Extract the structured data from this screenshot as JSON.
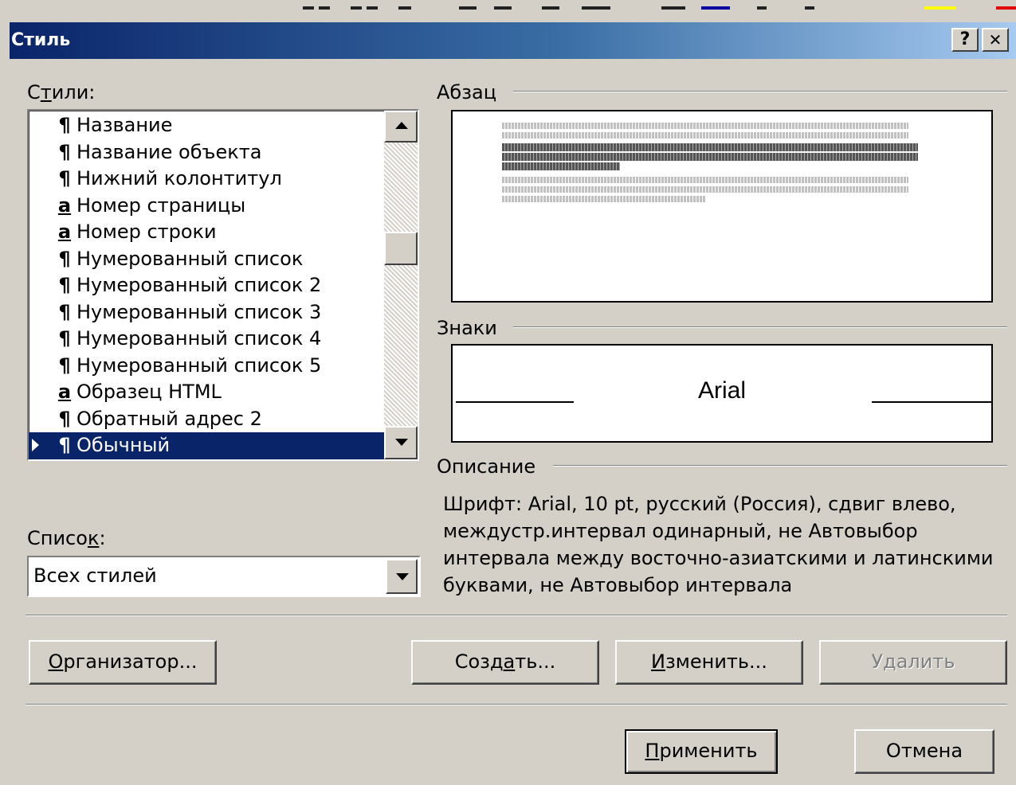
{
  "dialog": {
    "title": "Стиль",
    "help_button": "?",
    "close_button": "✕"
  },
  "styles_list": {
    "label_prefix": "С",
    "label_accel": "т",
    "label_suffix": "или:",
    "items": [
      {
        "glyph": "¶",
        "label": "Название"
      },
      {
        "glyph": "¶",
        "label": "Название объекта"
      },
      {
        "glyph": "¶",
        "label": "Нижний колонтитул"
      },
      {
        "glyph": "a",
        "label": "Номер страницы"
      },
      {
        "glyph": "a",
        "label": "Номер строки"
      },
      {
        "glyph": "¶",
        "label": "Нумерованный список"
      },
      {
        "glyph": "¶",
        "label": "Нумерованный список 2"
      },
      {
        "glyph": "¶",
        "label": "Нумерованный список 3"
      },
      {
        "glyph": "¶",
        "label": "Нумерованный список 4"
      },
      {
        "glyph": "¶",
        "label": "Нумерованный список 5"
      },
      {
        "glyph": "a",
        "label": "Образец HTML"
      },
      {
        "glyph": "¶",
        "label": "Обратный адрес 2"
      },
      {
        "glyph": "¶",
        "label": "Обычный"
      }
    ],
    "selected_label": "Обычный"
  },
  "list_combo": {
    "label_prefix": "Списо",
    "label_accel": "к",
    "label_suffix": ":",
    "value": "Всех стилей"
  },
  "paragraph_preview": {
    "title": "Абзац"
  },
  "chars_preview": {
    "title": "Знаки",
    "sample_text": "Arial"
  },
  "description": {
    "title": "Описание",
    "text": "Шрифт: Arial, 10 pt, русский (Россия), сдвиг влево, междустр.интервал одинарный, не Автовыбор интервала между восточно-азиатскими и латинскими буквами, не Автовыбор интервала"
  },
  "buttons": {
    "organizer": {
      "accel": "О",
      "rest": "рганизатор..."
    },
    "create": {
      "pre": "Созд",
      "accel": "а",
      "rest": "ть..."
    },
    "modify": {
      "accel": "И",
      "rest": "зменить..."
    },
    "delete": "Удалить",
    "apply": {
      "accel": "П",
      "rest": "рименить"
    },
    "cancel": "Отмена"
  }
}
